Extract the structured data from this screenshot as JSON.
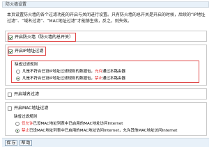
{
  "window": {
    "title": "防火墙设置"
  },
  "description": "本页设置防火墙的各个过滤功能的开启与关闭进行设置。只有防火墙的总开关是开启的时候，后续的“IP地址过滤”、“域名过滤”、“MAC地址过滤”才能够生效，反之，则失效。",
  "firewall": {
    "label": "开启防火墙（防火墙的总开关）",
    "checked": true
  },
  "ip_filter": {
    "label": "开启IP地址过滤",
    "checked": true,
    "default_rule_title": "缺省过滤规则",
    "options": [
      {
        "prefix": "凡是不符合已设IP地址过滤规则的数据包，",
        "action": "允许",
        "suffix": "通过本路由器",
        "selected": false
      },
      {
        "prefix": "凡是不符合已设IP地址过滤规则的数据包，",
        "action": "禁止",
        "suffix": "通过本路由器",
        "selected": true
      }
    ]
  },
  "domain_filter": {
    "label": "开启域名过滤",
    "checked": false
  },
  "mac_filter": {
    "label": "开启MAC地址过滤",
    "checked": false,
    "default_rule_title": "缺省过滤规则",
    "options": [
      {
        "prefix": "",
        "action": "仅允许",
        "suffix": "已设MAC地址列表中已启用的MAC地址访问Internet",
        "selected": false
      },
      {
        "prefix": "",
        "action": "禁止",
        "suffix": "已设MAC地址列表中已启用的MAC地址访问Internet，允许其他MAC地址访问Internet",
        "selected": true
      }
    ]
  },
  "buttons": {
    "save": "保 存",
    "help": "帮 助"
  }
}
